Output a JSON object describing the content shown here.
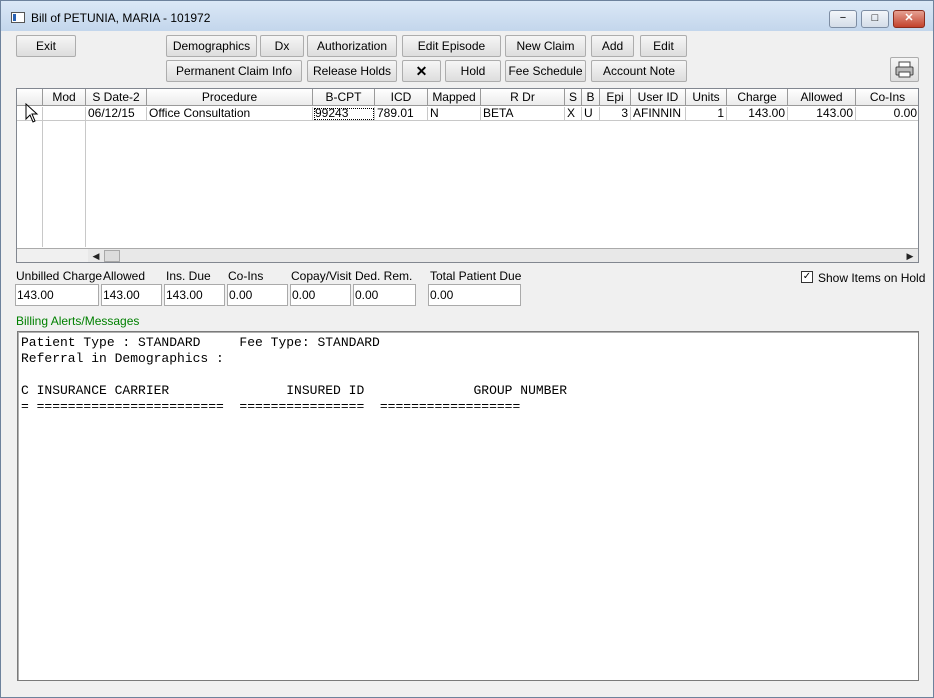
{
  "window": {
    "title": "Bill of PETUNIA, MARIA - 101972",
    "minimize": "−",
    "maximize": "□",
    "close": "✕"
  },
  "toolbar": {
    "exit": "Exit",
    "demographics": "Demographics",
    "dx": "Dx",
    "authorization": "Authorization",
    "edit_episode": "Edit Episode",
    "new_claim": "New Claim",
    "add": "Add",
    "edit": "Edit",
    "permanent_claim_info": "Permanent Claim Info",
    "release_holds": "Release Holds",
    "delete": "✕",
    "hold": "Hold",
    "fee_schedule": "Fee Schedule",
    "account_note": "Account Note",
    "print_icon": "printer-icon"
  },
  "grid": {
    "columns": [
      "Mod",
      "S Date-2",
      "Procedure",
      "B-CPT",
      "ICD",
      "Mapped",
      "R Dr",
      "S",
      "B",
      "Epi",
      "User ID",
      "Units",
      "Charge",
      "Allowed",
      "Co-Ins"
    ],
    "rows": [
      {
        "mod": "",
        "s_date": "06/12/15",
        "procedure": "Office Consultation",
        "b_cpt": "99243",
        "icd": "789.01",
        "mapped": "N",
        "r_dr": "BETA",
        "s": "X",
        "b": "U",
        "epi": "3",
        "user_id": "AFINNIN",
        "units": "1",
        "charge": "143.00",
        "allowed": "143.00",
        "co_ins": "0.00"
      }
    ]
  },
  "summary": {
    "labels": {
      "unbilled_charge": "Unbilled Charge",
      "allowed": "Allowed",
      "ins_due": "Ins. Due",
      "co_ins": "Co-Ins",
      "copay_visit": "Copay/Visit",
      "ded_rem": "Ded. Rem.",
      "total_patient_due": "Total Patient Due"
    },
    "values": {
      "unbilled_charge": "143.00",
      "allowed": "143.00",
      "ins_due": "143.00",
      "co_ins": "0.00",
      "copay_visit": "0.00",
      "ded_rem": "0.00",
      "total_patient_due": "0.00"
    }
  },
  "show_items_on_hold": {
    "label": "Show Items on Hold",
    "checked": true,
    "check_mark": "✓"
  },
  "alerts": {
    "title": "Billing Alerts/Messages",
    "text": "Patient Type : STANDARD     Fee Type: STANDARD\nReferral in Demographics :\n\nC INSURANCE CARRIER               INSURED ID              GROUP NUMBER\n= ========================  ================  =================="
  }
}
